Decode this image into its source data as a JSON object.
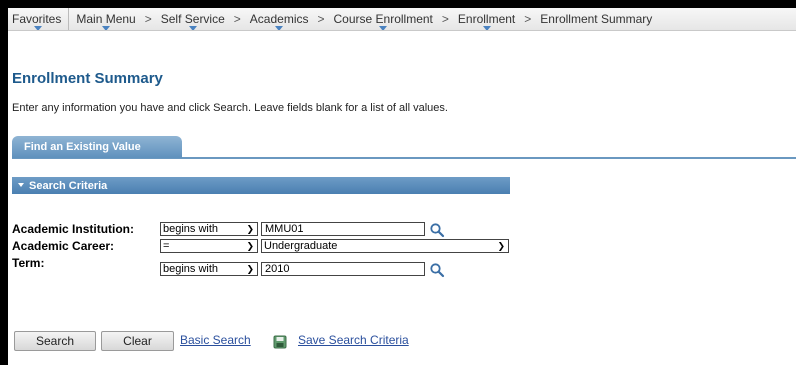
{
  "breadcrumb": {
    "items": [
      "Favorites",
      "Main Menu",
      "Self Service",
      "Academics",
      "Course Enrollment",
      "Enrollment",
      "Enrollment Summary"
    ],
    "separator": ">"
  },
  "page": {
    "title": "Enrollment Summary",
    "instructions": "Enter any information you have and click Search. Leave fields blank for a list of all values."
  },
  "tab": {
    "label": "Find an Existing Value"
  },
  "section": {
    "title": "Search Criteria"
  },
  "fields": {
    "institution": {
      "label": "Academic Institution:",
      "operator": "begins with",
      "value": "MMU01"
    },
    "career": {
      "label": "Academic Career:",
      "operator": "=",
      "value": "Undergraduate"
    },
    "term": {
      "label": "Term:",
      "operator": "begins with",
      "value": "2010"
    }
  },
  "actions": {
    "search": "Search",
    "clear": "Clear",
    "basic_search": "Basic Search",
    "save_search": "Save Search Criteria"
  },
  "icons": {
    "lookup": "magnifier-icon",
    "save": "save-icon",
    "dropdown": "chevron-down-icon"
  },
  "colors": {
    "title": "#1e5a8c",
    "tab": "#5f91bd",
    "link": "#2a4f9d"
  }
}
